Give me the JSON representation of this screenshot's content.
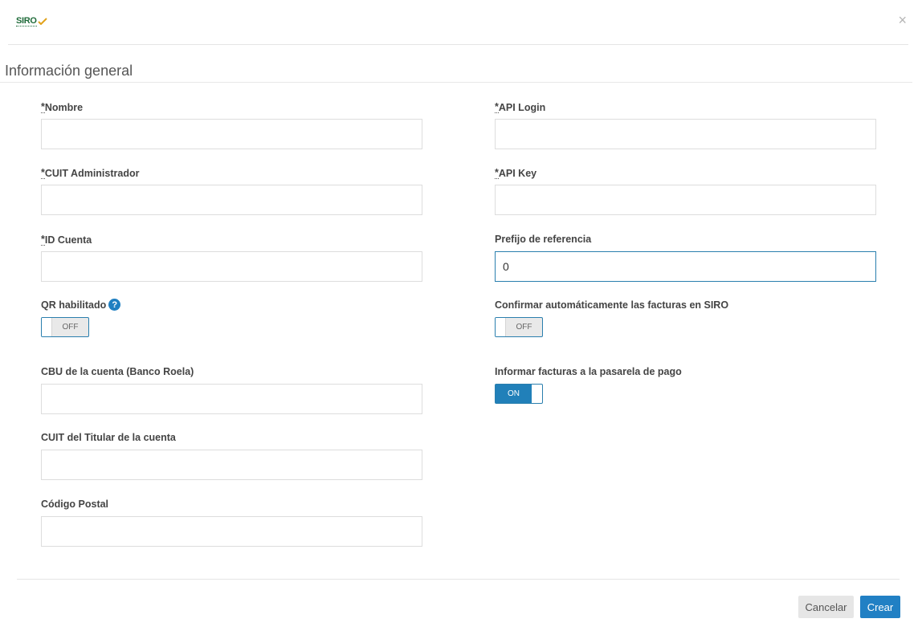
{
  "header": {
    "logo_text": "SIRO",
    "close_symbol": "×"
  },
  "section": {
    "title": "Información general"
  },
  "left_fields": {
    "nombre": {
      "req_mark": "*",
      "label": "Nombre",
      "value": ""
    },
    "cuit_admin": {
      "req_mark": "*",
      "label": "CUIT Administrador",
      "value": ""
    },
    "id_cuenta": {
      "req_mark": "*",
      "label": "ID Cuenta",
      "value": ""
    },
    "qr": {
      "label": "QR habilitado",
      "help_symbol": "?",
      "state": "OFF"
    },
    "cbu": {
      "label": "CBU de la cuenta (Banco Roela)",
      "value": ""
    },
    "cuit_titular": {
      "label": "CUIT del Titular de la cuenta",
      "value": ""
    },
    "codigo_postal": {
      "label": "Código Postal",
      "value": ""
    }
  },
  "right_fields": {
    "api_login": {
      "req_mark": "*",
      "label": "API Login",
      "value": ""
    },
    "api_key": {
      "req_mark": "*",
      "label": "API Key",
      "value": ""
    },
    "prefijo": {
      "label": "Prefijo de referencia",
      "value": "0"
    },
    "confirmar": {
      "label": "Confirmar automáticamente las facturas en SIRO",
      "state": "OFF"
    },
    "informar": {
      "label": "Informar facturas a la pasarela de pago",
      "state": "ON"
    }
  },
  "footer": {
    "cancel_label": "Cancelar",
    "create_label": "Crear"
  },
  "colors": {
    "primary": "#2180c4",
    "logo_green": "#1f6b3a",
    "logo_check": "#e2a21b"
  }
}
